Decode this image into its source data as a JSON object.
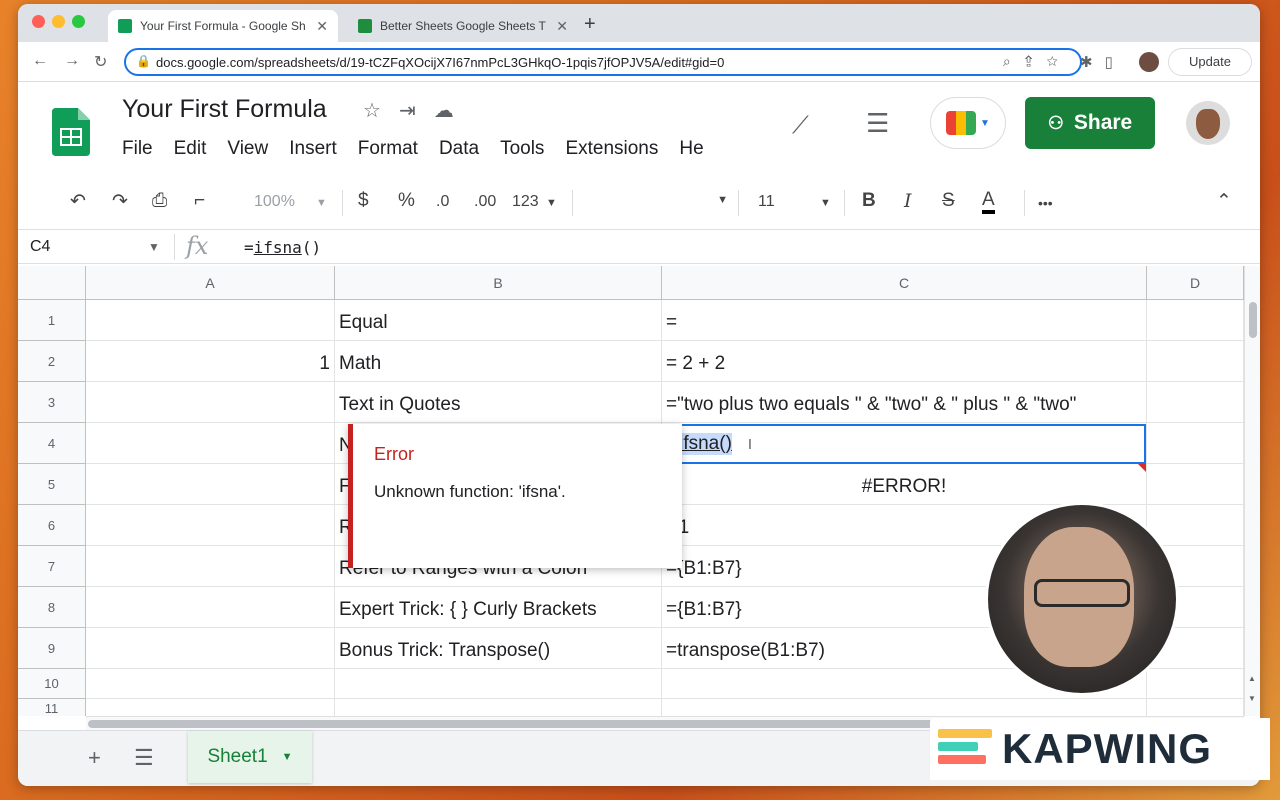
{
  "browser": {
    "tabs": [
      {
        "title": "Your First Formula - Google Sh"
      },
      {
        "title": "Better Sheets Google Sheets T"
      }
    ],
    "new_tab_label": "+",
    "url": "docs.google.com/spreadsheets/d/19-tCZFqXOcijX7I67nmPcL3GHkqO-1pqis7jfOPJV5A/edit#gid=0",
    "update_label": "Update"
  },
  "sheets": {
    "doc_title": "Your First Formula",
    "menu": [
      "File",
      "Edit",
      "View",
      "Insert",
      "Format",
      "Data",
      "Tools",
      "Extensions",
      "He"
    ],
    "share_label": "Share"
  },
  "toolbar": {
    "zoom": "100%",
    "currency": "$",
    "percent": "%",
    "dec_decrease": ".0",
    "dec_increase": ".00",
    "format_more": "123",
    "font_size": "11",
    "bold": "B",
    "italic": "I",
    "strike": "S",
    "text_color": "A",
    "more": "•••"
  },
  "formula_bar": {
    "cell_ref": "C4",
    "fx_label": "fx",
    "prefix": "=",
    "func": "ifsna",
    "suffix": "()"
  },
  "grid": {
    "columns": [
      "A",
      "B",
      "C",
      "D"
    ],
    "rows": [
      {
        "num": "1",
        "a": "",
        "b": "Equal",
        "c": "="
      },
      {
        "num": "2",
        "a": "1",
        "b": "Math",
        "c": "= 2 + 2"
      },
      {
        "num": "3",
        "a": "",
        "b": "Text in Quotes",
        "c": "=\"two plus two equals \" & \"two\" & \" plus \" & \"two\""
      },
      {
        "num": "4",
        "a": "",
        "b": "N",
        "c": ""
      },
      {
        "num": "5",
        "a": "",
        "b": "F",
        "c": "#ERROR!"
      },
      {
        "num": "6",
        "a": "",
        "b": "R",
        "c": "B1"
      },
      {
        "num": "7",
        "a": "",
        "b": "Refer to Ranges with a Colon",
        "c": "={B1:B7}"
      },
      {
        "num": "8",
        "a": "",
        "b": "Expert Trick: { } Curly Brackets",
        "c": "={B1:B7}"
      },
      {
        "num": "9",
        "a": "",
        "b": "Bonus Trick: Transpose()",
        "c": "=transpose(B1:B7)"
      },
      {
        "num": "10",
        "a": "",
        "b": "",
        "c": ""
      },
      {
        "num": "11",
        "a": "",
        "b": "",
        "c": ""
      }
    ],
    "active_cell": {
      "prefix": "=",
      "func": "ifsna()",
      "cursor": "I"
    }
  },
  "error_popup": {
    "title": "Error",
    "message": "Unknown function: 'ifsna'."
  },
  "sheet_tabs": {
    "add_label": "+",
    "active_sheet": "Sheet1"
  },
  "watermark": {
    "text": "KAPWING"
  },
  "colors": {
    "share_green": "#188038",
    "selection_blue": "#1a73e8",
    "error_red": "#c5221f"
  }
}
